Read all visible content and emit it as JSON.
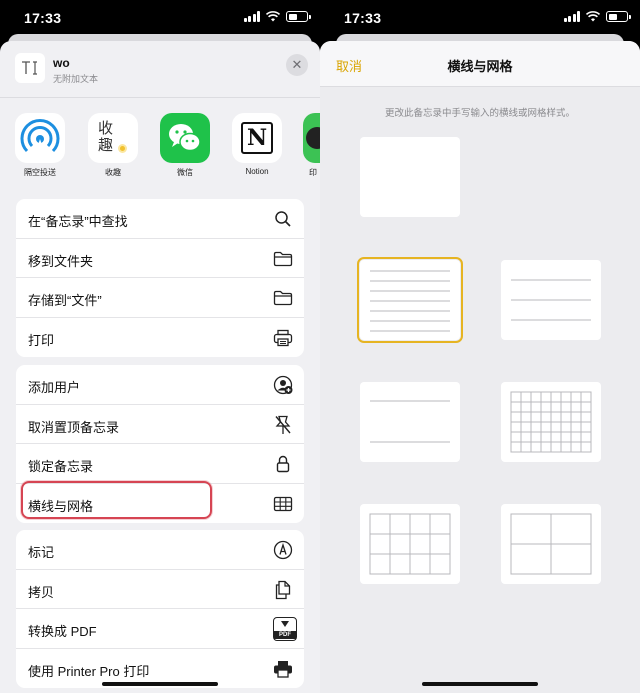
{
  "status": {
    "time": "17:33"
  },
  "share_sheet": {
    "doc_title": "wo",
    "doc_subtitle": "无附加文本",
    "doc_thumb_glyph": "T͟I",
    "close_glyph": "✕",
    "apps": [
      {
        "label": "隔空投送",
        "icon": "airdrop-icon"
      },
      {
        "label": "收趣",
        "icon": "shouqu-icon",
        "glyph_top": "收",
        "glyph_bottom": "趣"
      },
      {
        "label": "微信",
        "icon": "wechat-icon"
      },
      {
        "label": "Notion",
        "icon": "notion-icon",
        "glyph": "N"
      },
      {
        "label": "印",
        "icon": "printer-app-icon"
      }
    ],
    "group1": [
      {
        "label": "在“备忘录”中查找",
        "icon": "search-icon"
      },
      {
        "label": "移到文件夹",
        "icon": "folder-icon"
      },
      {
        "label": "存储到“文件”",
        "icon": "folder-icon"
      },
      {
        "label": "打印",
        "icon": "printer-icon"
      }
    ],
    "group2": [
      {
        "label": "添加用户",
        "icon": "add-person-icon"
      },
      {
        "label": "取消置顶备忘录",
        "icon": "unpin-icon"
      },
      {
        "label": "锁定备忘录",
        "icon": "lock-icon"
      },
      {
        "label": "横线与网格",
        "icon": "grid-icon"
      }
    ],
    "group3": [
      {
        "label": "标记",
        "icon": "markup-icon"
      },
      {
        "label": "拷贝",
        "icon": "copy-icon"
      },
      {
        "label": "转换成 PDF",
        "icon": "pdf-icon",
        "icon_text": "PDF"
      },
      {
        "label": "使用 Printer Pro 打印",
        "icon": "print-icon"
      }
    ]
  },
  "lines_grids": {
    "cancel_label": "取消",
    "title": "横线与网格",
    "hint": "更改此备忘录中手写输入的横线或网格样式。",
    "accent_color": "#E6B422",
    "options": [
      {
        "name": "blank",
        "selected": false
      },
      {
        "name": "narrow-lines",
        "selected": true
      },
      {
        "name": "medium-lines",
        "selected": false
      },
      {
        "name": "wide-lines",
        "selected": false
      },
      {
        "name": "small-grid",
        "selected": false
      },
      {
        "name": "medium-grid",
        "selected": false
      },
      {
        "name": "large-grid",
        "selected": false
      }
    ]
  }
}
